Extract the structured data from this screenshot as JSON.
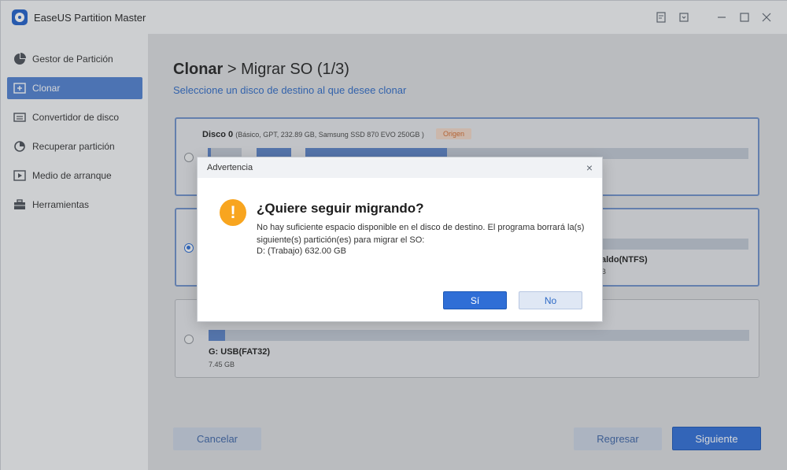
{
  "app": {
    "title": "EaseUS Partition Master",
    "icons": [
      "feedback-icon",
      "minimize-to-tray-icon",
      "minimize-icon",
      "maximize-icon",
      "close-icon"
    ]
  },
  "sidebar": {
    "items": [
      {
        "label": "Gestor de Partición",
        "icon": "pie-chart-icon",
        "active": false
      },
      {
        "label": "Clonar",
        "icon": "clone-icon",
        "active": true
      },
      {
        "label": "Convertidor de disco",
        "icon": "disk-convert-icon",
        "active": false
      },
      {
        "label": "Recuperar partición",
        "icon": "recover-icon",
        "active": false
      },
      {
        "label": "Medio de arranque",
        "icon": "boot-media-icon",
        "active": false
      },
      {
        "label": "Herramientas",
        "icon": "toolbox-icon",
        "active": false
      }
    ]
  },
  "main": {
    "heading_bold": "Clonar",
    "heading_sep": " > ",
    "heading_rest": "Migrar SO (1/3)",
    "subtitle": "Seleccione un disco de destino al que desee clonar"
  },
  "disks": [
    {
      "name": "Disco 0",
      "detail": "(Básico, GPT, 232.89 GB, Samsung SSD 870 EVO 250GB )",
      "badge": "Origen"
    },
    {
      "partition_label": "aldo(NTFS)",
      "partition_size": "B"
    },
    {
      "partition_label": "G: USB(FAT32)",
      "partition_size": "7.45 GB"
    }
  ],
  "footer": {
    "cancel": "Cancelar",
    "back": "Regresar",
    "next": "Siguiente"
  },
  "dialog": {
    "title": "Advertencia",
    "close_icon": "×",
    "warning_glyph": "!",
    "heading": "¿Quiere seguir migrando?",
    "message": "No hay suficiente espacio disponible en el disco de destino. El programa borrará la(s) siguiente(s) partición(es) para migrar el SO:",
    "partition": "D: (Trabajo) 632.00 GB",
    "yes": "Sí",
    "no": "No"
  }
}
